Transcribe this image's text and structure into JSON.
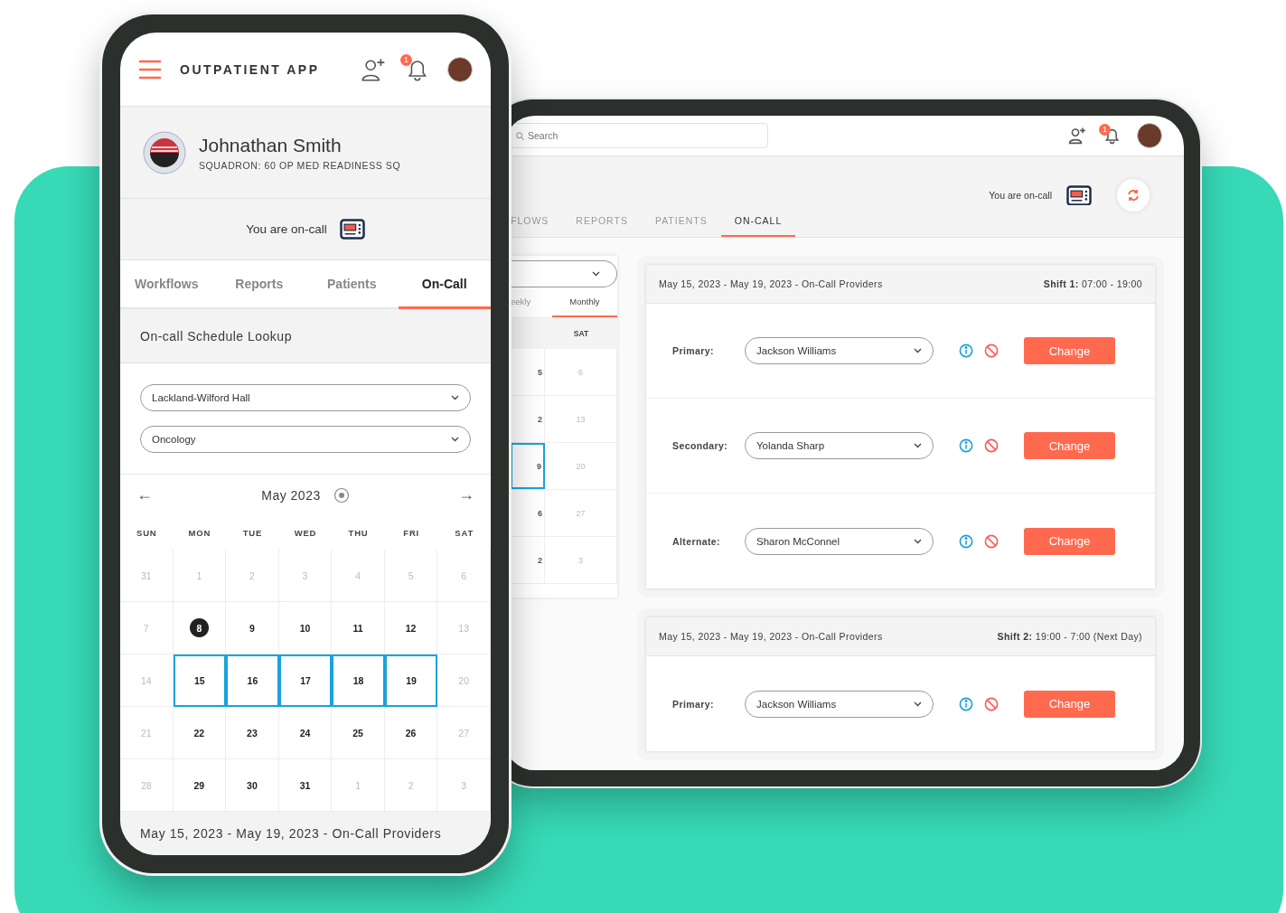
{
  "phone": {
    "app_title": "OUTPATIENT APP",
    "notification_count": "1",
    "profile": {
      "name": "Johnathan Smith",
      "squadron": "SQUADRON: 60 OP MED READINESS SQ"
    },
    "on_call_status": "You are on-call",
    "tabs": [
      {
        "label": "Workflows",
        "selected": false
      },
      {
        "label": "Reports",
        "selected": false
      },
      {
        "label": "Patients",
        "selected": false
      },
      {
        "label": "On-Call",
        "selected": true
      }
    ],
    "lookup_title": "On-call Schedule Lookup",
    "dropdowns": [
      "Lackland-Wilford Hall",
      "Oncology"
    ],
    "calendar": {
      "prev": "←",
      "month": "May 2023",
      "next": "→",
      "weekdays": [
        "SUN",
        "MON",
        "TUE",
        "WED",
        "THU",
        "FRI",
        "SAT"
      ],
      "weeks": [
        [
          {
            "day": "31",
            "muted": true,
            "today": false,
            "selected": false
          },
          {
            "day": "1",
            "muted": true,
            "today": false,
            "selected": false
          },
          {
            "day": "2",
            "muted": true,
            "today": false,
            "selected": false
          },
          {
            "day": "3",
            "muted": true,
            "today": false,
            "selected": false
          },
          {
            "day": "4",
            "muted": true,
            "today": false,
            "selected": false
          },
          {
            "day": "5",
            "muted": true,
            "today": false,
            "selected": false
          },
          {
            "day": "6",
            "muted": true,
            "today": false,
            "selected": false
          }
        ],
        [
          {
            "day": "7",
            "muted": true,
            "today": false,
            "selected": false
          },
          {
            "day": "8",
            "muted": false,
            "today": true,
            "selected": false
          },
          {
            "day": "9",
            "muted": false,
            "today": false,
            "selected": false
          },
          {
            "day": "10",
            "muted": false,
            "today": false,
            "selected": false
          },
          {
            "day": "11",
            "muted": false,
            "today": false,
            "selected": false
          },
          {
            "day": "12",
            "muted": false,
            "today": false,
            "selected": false
          },
          {
            "day": "13",
            "muted": true,
            "today": false,
            "selected": false
          }
        ],
        [
          {
            "day": "14",
            "muted": true,
            "today": false,
            "selected": false
          },
          {
            "day": "15",
            "muted": false,
            "today": false,
            "selected": true
          },
          {
            "day": "16",
            "muted": false,
            "today": false,
            "selected": true
          },
          {
            "day": "17",
            "muted": false,
            "today": false,
            "selected": true
          },
          {
            "day": "18",
            "muted": false,
            "today": false,
            "selected": true
          },
          {
            "day": "19",
            "muted": false,
            "today": false,
            "selected": true
          },
          {
            "day": "20",
            "muted": true,
            "today": false,
            "selected": false
          }
        ],
        [
          {
            "day": "21",
            "muted": true,
            "today": false,
            "selected": false
          },
          {
            "day": "22",
            "muted": false,
            "today": false,
            "selected": false
          },
          {
            "day": "23",
            "muted": false,
            "today": false,
            "selected": false
          },
          {
            "day": "24",
            "muted": false,
            "today": false,
            "selected": false
          },
          {
            "day": "25",
            "muted": false,
            "today": false,
            "selected": false
          },
          {
            "day": "26",
            "muted": false,
            "today": false,
            "selected": false
          },
          {
            "day": "27",
            "muted": true,
            "today": false,
            "selected": false
          }
        ],
        [
          {
            "day": "28",
            "muted": true,
            "today": false,
            "selected": false
          },
          {
            "day": "29",
            "muted": false,
            "today": false,
            "selected": false
          },
          {
            "day": "30",
            "muted": false,
            "today": false,
            "selected": false
          },
          {
            "day": "31",
            "muted": false,
            "today": false,
            "selected": false
          },
          {
            "day": "1",
            "muted": true,
            "today": false,
            "selected": false
          },
          {
            "day": "2",
            "muted": true,
            "today": false,
            "selected": false
          },
          {
            "day": "3",
            "muted": true,
            "today": false,
            "selected": false
          }
        ]
      ]
    },
    "footer": "May 15, 2023 - May 19, 2023 - On-Call Providers"
  },
  "tablet": {
    "search": {
      "placeholder": "Search"
    },
    "notification_count": "1",
    "on_call_status": "You are on-call",
    "tabs": [
      {
        "label": "FLOWS",
        "selected": false
      },
      {
        "label": "REPORTS",
        "selected": false
      },
      {
        "label": "PATIENTS",
        "selected": false
      },
      {
        "label": "ON-CALL",
        "selected": true
      }
    ],
    "view_tabs": [
      {
        "label": "eekly",
        "selected": false
      },
      {
        "label": "Monthly",
        "selected": true
      }
    ],
    "mini_calendar": {
      "weekday": "SAT",
      "rows": [
        {
          "column_1": "5",
          "day": "6",
          "selected": false
        },
        {
          "column_1": "2",
          "day": "13",
          "selected": false
        },
        {
          "column_1": "9",
          "day": "20",
          "selected": true
        },
        {
          "column_1": "6",
          "day": "27",
          "selected": false
        },
        {
          "column_1": "2",
          "day": "3",
          "selected": false
        }
      ]
    },
    "schedules": [
      {
        "title": "May 15, 2023 - May 19, 2023 - On-Call Providers",
        "shift_label": "Shift 1:",
        "shift_time": "07:00 - 19:00",
        "rows": [
          {
            "role": "Primary:",
            "provider": "Jackson Williams",
            "action": "Change"
          },
          {
            "role": "Secondary:",
            "provider": "Yolanda Sharp",
            "action": "Change"
          },
          {
            "role": "Alternate:",
            "provider": "Sharon McConnel",
            "action": "Change"
          }
        ]
      },
      {
        "title": "May 15, 2023 - May 19, 2023 - On-Call Providers",
        "shift_label": "Shift 2:",
        "shift_time": "19:00 - 7:00 (Next Day)",
        "rows": [
          {
            "role": "Primary:",
            "provider": "Jackson Williams",
            "action": "Change"
          }
        ]
      }
    ]
  }
}
